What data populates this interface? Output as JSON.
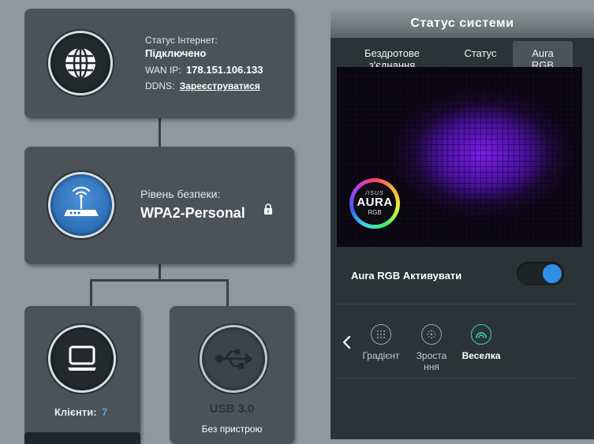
{
  "internet": {
    "status_label": "Статус Інтернет:",
    "status_value": "Підключено",
    "wan_label": "WAN IP:",
    "wan_value": "178.151.106.133",
    "ddns_label": "DDNS:",
    "ddns_link": "Зареєструватися"
  },
  "security": {
    "label": "Рівень безпеки:",
    "value": "WPA2-Personal"
  },
  "clients": {
    "label": "Клієнти:",
    "count": "7"
  },
  "usb": {
    "label": "USB 3.0",
    "status": "Без пристрою"
  },
  "panel": {
    "title": "Статус системи",
    "tabs": [
      {
        "label": "Бездротове з'єднання"
      },
      {
        "label": "Статус"
      },
      {
        "label": "Aura RGB"
      }
    ],
    "aura_badge": {
      "brand": "/ISUS",
      "word": "AURA",
      "sub": "RGB"
    },
    "toggle_label": "Aura RGB Активувати",
    "toggle_on": true,
    "effects": [
      {
        "label": "Градієнт",
        "icon": "gradient-icon"
      },
      {
        "label": "Зростання",
        "icon": "growth-icon"
      },
      {
        "label": "Веселка",
        "icon": "rainbow-icon",
        "active": true
      }
    ]
  },
  "colors": {
    "accent_blue": "#2e8fe8",
    "accent_teal": "#3ed1b6",
    "background": "#8e989e",
    "card": "#4b5358"
  }
}
